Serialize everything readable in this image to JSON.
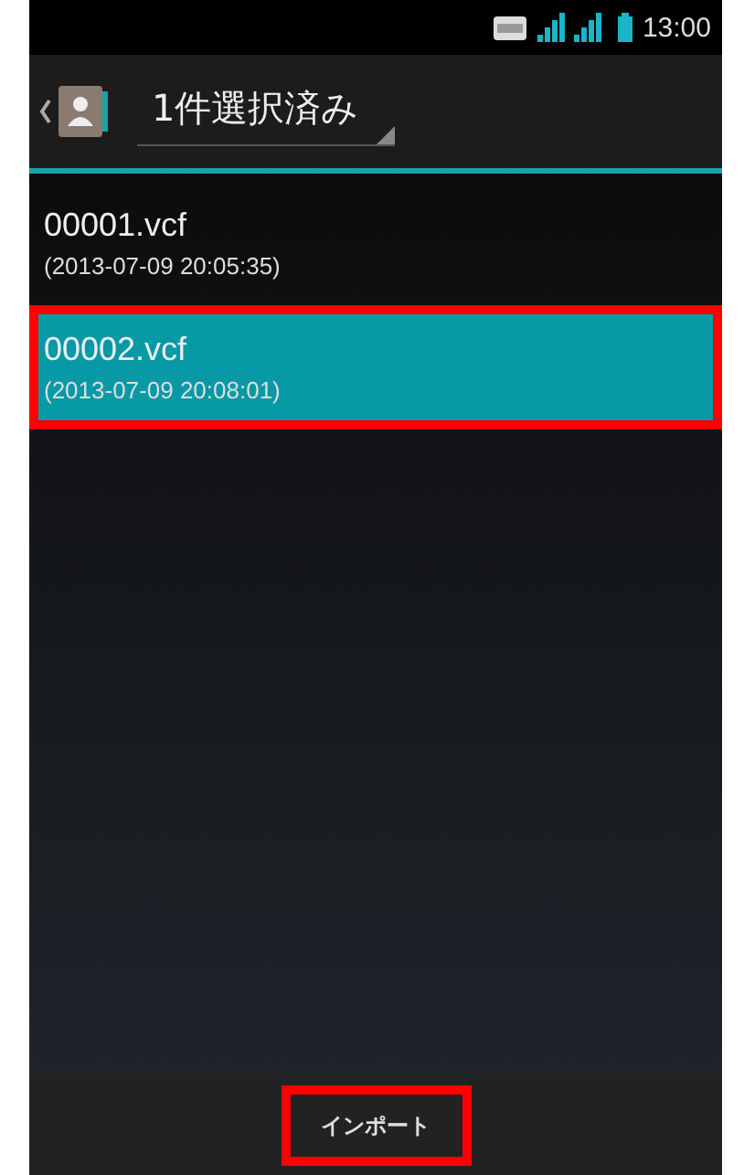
{
  "status_bar": {
    "time": "13:00"
  },
  "action_bar": {
    "title": "1件選択済み"
  },
  "files": [
    {
      "name": "00001.vcf",
      "date": "(2013-07-09 20:05:35)",
      "selected": false,
      "highlighted": false
    },
    {
      "name": "00002.vcf",
      "date": "(2013-07-09 20:08:01)",
      "selected": true,
      "highlighted": true
    }
  ],
  "bottom_bar": {
    "button": {
      "label": "インポート",
      "highlighted": true
    }
  }
}
